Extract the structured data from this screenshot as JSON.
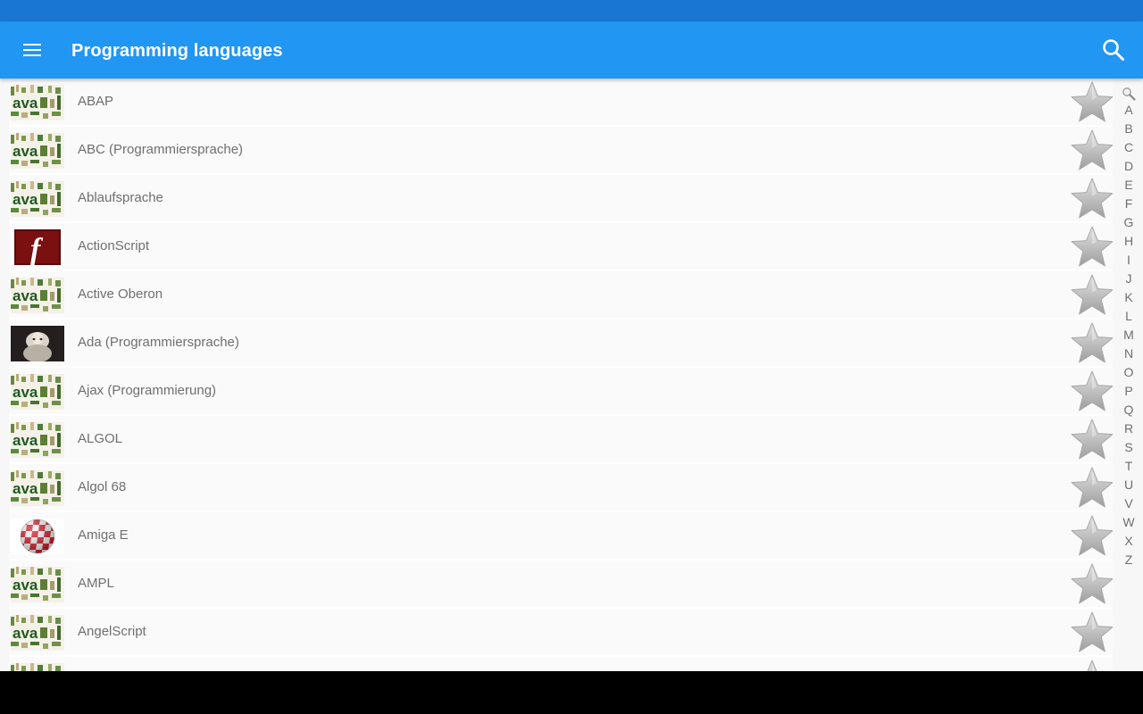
{
  "app_bar": {
    "title": "Programming languages",
    "menu_icon": "menu-icon",
    "search_icon": "search-icon",
    "color": "#2196f3",
    "status_bar_color": "#1976d2"
  },
  "items": [
    {
      "label": "ABAP",
      "icon": "java-collage-thumbnail"
    },
    {
      "label": "ABC (Programmiersprache)",
      "icon": "java-collage-thumbnail"
    },
    {
      "label": "Ablaufsprache",
      "icon": "java-collage-thumbnail"
    },
    {
      "label": "ActionScript",
      "icon": "flash-logo-thumbnail"
    },
    {
      "label": "Active Oberon",
      "icon": "java-collage-thumbnail"
    },
    {
      "label": "Ada (Programmiersprache)",
      "icon": "ada-portrait-thumbnail"
    },
    {
      "label": "Ajax (Programmierung)",
      "icon": "java-collage-thumbnail"
    },
    {
      "label": "ALGOL",
      "icon": "java-collage-thumbnail"
    },
    {
      "label": "Algol 68",
      "icon": "java-collage-thumbnail"
    },
    {
      "label": "Amiga E",
      "icon": "amiga-boing-ball-thumbnail"
    },
    {
      "label": "AMPL",
      "icon": "java-collage-thumbnail"
    },
    {
      "label": "AngelScript",
      "icon": "java-collage-thumbnail"
    },
    {
      "label": "",
      "icon": "java-collage-thumbnail"
    }
  ],
  "favorite_icon": "star-icon",
  "alphabet_index": [
    "A",
    "B",
    "C",
    "D",
    "E",
    "F",
    "G",
    "H",
    "I",
    "J",
    "K",
    "L",
    "M",
    "N",
    "O",
    "P",
    "Q",
    "R",
    "S",
    "T",
    "U",
    "V",
    "W",
    "X",
    "Z"
  ],
  "alphabet_search_icon": "magnifier-icon"
}
